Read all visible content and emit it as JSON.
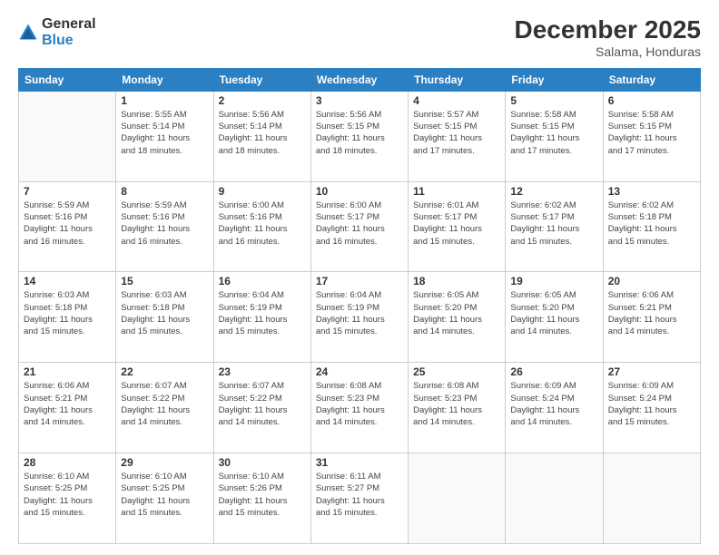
{
  "header": {
    "logo_general": "General",
    "logo_blue": "Blue",
    "month_title": "December 2025",
    "subtitle": "Salama, Honduras"
  },
  "days_of_week": [
    "Sunday",
    "Monday",
    "Tuesday",
    "Wednesday",
    "Thursday",
    "Friday",
    "Saturday"
  ],
  "weeks": [
    [
      {
        "day": "",
        "info": ""
      },
      {
        "day": "1",
        "info": "Sunrise: 5:55 AM\nSunset: 5:14 PM\nDaylight: 11 hours\nand 18 minutes."
      },
      {
        "day": "2",
        "info": "Sunrise: 5:56 AM\nSunset: 5:14 PM\nDaylight: 11 hours\nand 18 minutes."
      },
      {
        "day": "3",
        "info": "Sunrise: 5:56 AM\nSunset: 5:15 PM\nDaylight: 11 hours\nand 18 minutes."
      },
      {
        "day": "4",
        "info": "Sunrise: 5:57 AM\nSunset: 5:15 PM\nDaylight: 11 hours\nand 17 minutes."
      },
      {
        "day": "5",
        "info": "Sunrise: 5:58 AM\nSunset: 5:15 PM\nDaylight: 11 hours\nand 17 minutes."
      },
      {
        "day": "6",
        "info": "Sunrise: 5:58 AM\nSunset: 5:15 PM\nDaylight: 11 hours\nand 17 minutes."
      }
    ],
    [
      {
        "day": "7",
        "info": "Sunrise: 5:59 AM\nSunset: 5:16 PM\nDaylight: 11 hours\nand 16 minutes."
      },
      {
        "day": "8",
        "info": "Sunrise: 5:59 AM\nSunset: 5:16 PM\nDaylight: 11 hours\nand 16 minutes."
      },
      {
        "day": "9",
        "info": "Sunrise: 6:00 AM\nSunset: 5:16 PM\nDaylight: 11 hours\nand 16 minutes."
      },
      {
        "day": "10",
        "info": "Sunrise: 6:00 AM\nSunset: 5:17 PM\nDaylight: 11 hours\nand 16 minutes."
      },
      {
        "day": "11",
        "info": "Sunrise: 6:01 AM\nSunset: 5:17 PM\nDaylight: 11 hours\nand 15 minutes."
      },
      {
        "day": "12",
        "info": "Sunrise: 6:02 AM\nSunset: 5:17 PM\nDaylight: 11 hours\nand 15 minutes."
      },
      {
        "day": "13",
        "info": "Sunrise: 6:02 AM\nSunset: 5:18 PM\nDaylight: 11 hours\nand 15 minutes."
      }
    ],
    [
      {
        "day": "14",
        "info": "Sunrise: 6:03 AM\nSunset: 5:18 PM\nDaylight: 11 hours\nand 15 minutes."
      },
      {
        "day": "15",
        "info": "Sunrise: 6:03 AM\nSunset: 5:18 PM\nDaylight: 11 hours\nand 15 minutes."
      },
      {
        "day": "16",
        "info": "Sunrise: 6:04 AM\nSunset: 5:19 PM\nDaylight: 11 hours\nand 15 minutes."
      },
      {
        "day": "17",
        "info": "Sunrise: 6:04 AM\nSunset: 5:19 PM\nDaylight: 11 hours\nand 15 minutes."
      },
      {
        "day": "18",
        "info": "Sunrise: 6:05 AM\nSunset: 5:20 PM\nDaylight: 11 hours\nand 14 minutes."
      },
      {
        "day": "19",
        "info": "Sunrise: 6:05 AM\nSunset: 5:20 PM\nDaylight: 11 hours\nand 14 minutes."
      },
      {
        "day": "20",
        "info": "Sunrise: 6:06 AM\nSunset: 5:21 PM\nDaylight: 11 hours\nand 14 minutes."
      }
    ],
    [
      {
        "day": "21",
        "info": "Sunrise: 6:06 AM\nSunset: 5:21 PM\nDaylight: 11 hours\nand 14 minutes."
      },
      {
        "day": "22",
        "info": "Sunrise: 6:07 AM\nSunset: 5:22 PM\nDaylight: 11 hours\nand 14 minutes."
      },
      {
        "day": "23",
        "info": "Sunrise: 6:07 AM\nSunset: 5:22 PM\nDaylight: 11 hours\nand 14 minutes."
      },
      {
        "day": "24",
        "info": "Sunrise: 6:08 AM\nSunset: 5:23 PM\nDaylight: 11 hours\nand 14 minutes."
      },
      {
        "day": "25",
        "info": "Sunrise: 6:08 AM\nSunset: 5:23 PM\nDaylight: 11 hours\nand 14 minutes."
      },
      {
        "day": "26",
        "info": "Sunrise: 6:09 AM\nSunset: 5:24 PM\nDaylight: 11 hours\nand 14 minutes."
      },
      {
        "day": "27",
        "info": "Sunrise: 6:09 AM\nSunset: 5:24 PM\nDaylight: 11 hours\nand 15 minutes."
      }
    ],
    [
      {
        "day": "28",
        "info": "Sunrise: 6:10 AM\nSunset: 5:25 PM\nDaylight: 11 hours\nand 15 minutes."
      },
      {
        "day": "29",
        "info": "Sunrise: 6:10 AM\nSunset: 5:25 PM\nDaylight: 11 hours\nand 15 minutes."
      },
      {
        "day": "30",
        "info": "Sunrise: 6:10 AM\nSunset: 5:26 PM\nDaylight: 11 hours\nand 15 minutes."
      },
      {
        "day": "31",
        "info": "Sunrise: 6:11 AM\nSunset: 5:27 PM\nDaylight: 11 hours\nand 15 minutes."
      },
      {
        "day": "",
        "info": ""
      },
      {
        "day": "",
        "info": ""
      },
      {
        "day": "",
        "info": ""
      }
    ]
  ]
}
